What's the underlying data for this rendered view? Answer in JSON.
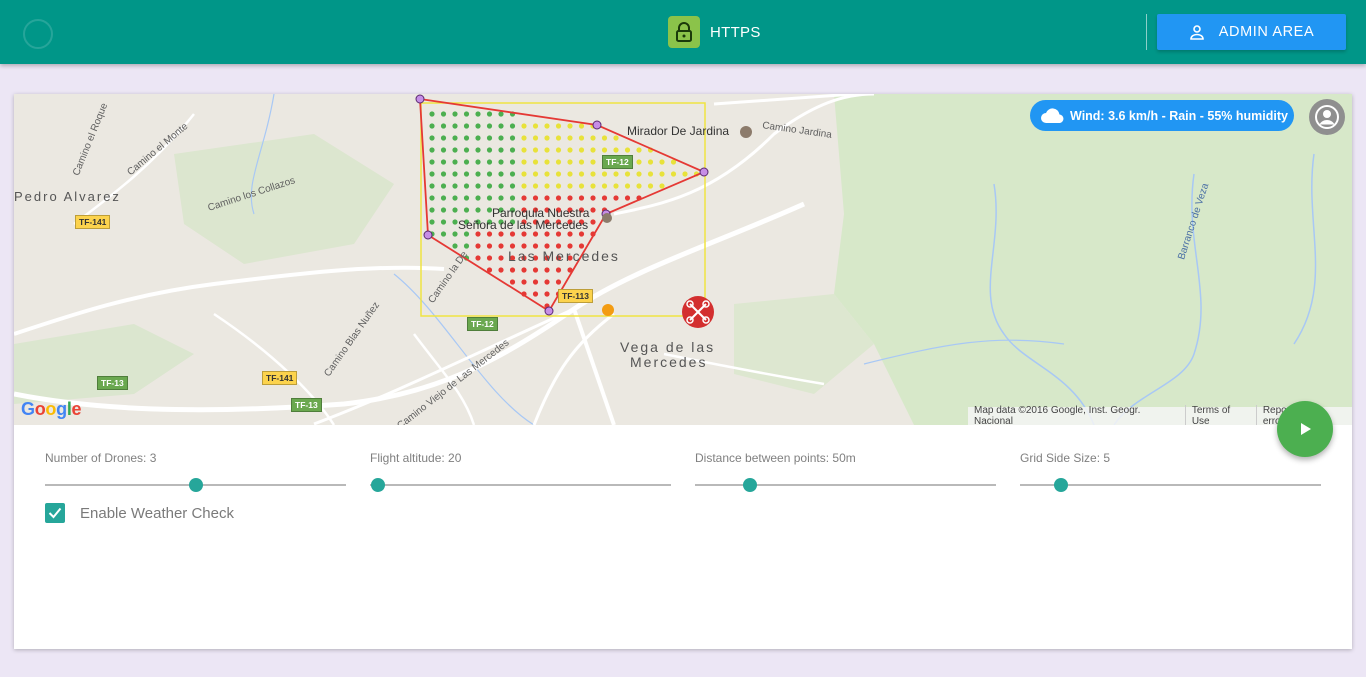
{
  "header": {
    "status_label": "HTTPS",
    "admin_button_label": "ADMIN AREA",
    "icons": {
      "status": "lock-icon",
      "admin": "person-icon"
    },
    "colors": {
      "bar": "#009688",
      "status_badge": "#8bc34a",
      "admin_button": "#2196f3"
    }
  },
  "map": {
    "weather": "Wind: 3.6 km/h - Rain - 55% humidity",
    "places": {
      "mirador": "Mirador De Jardina",
      "camino_jardina": "Camino Jardina",
      "pedro_alvarez": "Pedro Alvarez",
      "camino_el_roque": "Camino el Roque",
      "camino_el_monte": "Camino el Monte",
      "camino_los_collazos": "Camino los Collazos",
      "parroquia_1": "Parroquia Nuestra",
      "parroquia_2": "Señora de las Mercedes",
      "las_mercedes": "Las Mercedes",
      "camino_la_de": "Camino la De",
      "camino_blas": "Camino Blas Nuñez",
      "camino_viejo": "Camino Viejo de Las Mercedes",
      "vega_1": "Vega de las",
      "vega_2": "Mercedes",
      "barranco": "Barranco de Veza"
    },
    "road_signs": {
      "tf141_a": "TF-141",
      "tf12_a": "TF-12",
      "tf113": "TF-113",
      "tf12_b": "TF-12",
      "tf13_a": "TF-13",
      "tf141_b": "TF-141",
      "tf13_b": "TF-13"
    },
    "google_logo": "Google",
    "footer": {
      "data": "Map data ©2016 Google, Inst. Geogr. Nacional",
      "terms": "Terms of Use",
      "report": "Report a map error"
    },
    "colors": {
      "route": "#e53935",
      "grid_box": "#f0e442",
      "point_green": "#4caf50",
      "point_yellow": "#e8e23a",
      "point_red": "#e53935",
      "drone_marker": "#d32f2f"
    }
  },
  "controls": {
    "drones": {
      "label": "Number of Drones: 3",
      "value": 3
    },
    "altitude": {
      "label": "Flight altitude: 20",
      "value": 20
    },
    "distance": {
      "label": "Distance between points: 50m",
      "value": 50
    },
    "grid": {
      "label": "Grid Side Size: 5",
      "value": 5
    },
    "weather_check": {
      "label": "Enable Weather Check",
      "checked": true
    },
    "play_icon": "play-icon",
    "accent": "#26a69a"
  }
}
